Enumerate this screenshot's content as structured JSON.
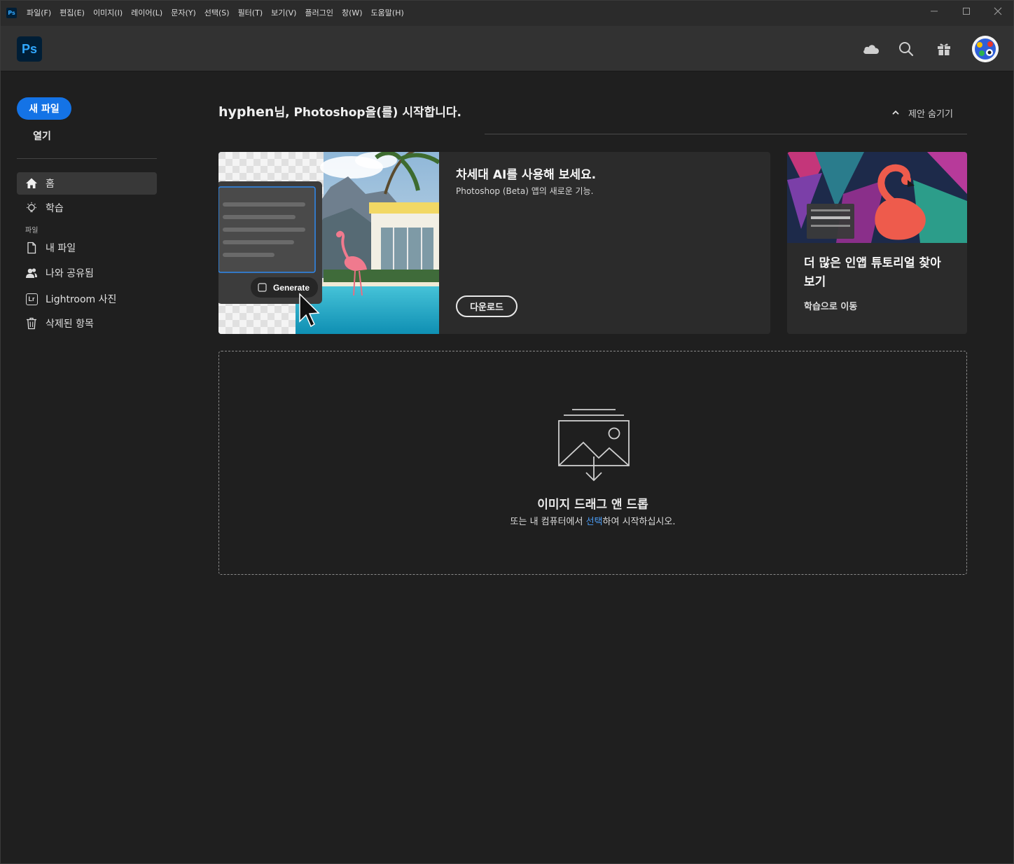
{
  "titlebar": {
    "logo_text": "Ps",
    "menu": [
      "파일(F)",
      "편집(E)",
      "이미지(I)",
      "레이어(L)",
      "문자(Y)",
      "선택(S)",
      "필터(T)",
      "보기(V)",
      "플러그인",
      "창(W)",
      "도움말(H)"
    ]
  },
  "header": {
    "logo_text": "Ps",
    "icons": [
      "cloud-icon",
      "search-icon",
      "gift-icon",
      "avatar"
    ]
  },
  "sidebar": {
    "new_file": "새 파일",
    "open": "열기",
    "section_files": "파일",
    "items": [
      {
        "label": "홈",
        "icon": "home-icon"
      },
      {
        "label": "학습",
        "icon": "lightbulb-icon"
      },
      {
        "label": "내 파일",
        "icon": "file-icon"
      },
      {
        "label": "나와 공유됨",
        "icon": "people-icon"
      },
      {
        "label": "Lightroom 사진",
        "icon": "lightroom-icon",
        "badge": "Lr"
      },
      {
        "label": "삭제된 항목",
        "icon": "trash-icon"
      }
    ]
  },
  "main": {
    "greeting_name": "hyphen",
    "greeting_rest": "님, Photoshop을(를) 시작합니다.",
    "hide_suggestions": "제안 숨기기",
    "promo": {
      "title": "차세대 AI를 사용해 보세요.",
      "subtitle": "Photoshop (Beta) 앱의 새로운 기능.",
      "button": "다운로드",
      "image_button": "Generate"
    },
    "tutorial": {
      "title": "더 많은 인앱 튜토리얼 찾아보기",
      "link": "학습으로 이동"
    },
    "dropzone": {
      "title": "이미지 드래그 앤 드롭",
      "sub_before": "또는 내 컴퓨터에서 ",
      "sub_link": "선택",
      "sub_after": "하여 시작하십시오."
    }
  },
  "colors": {
    "accent": "#1473e6",
    "link": "#4b9cf5",
    "ps_blue": "#31a8ff",
    "ps_bg": "#001e36"
  }
}
